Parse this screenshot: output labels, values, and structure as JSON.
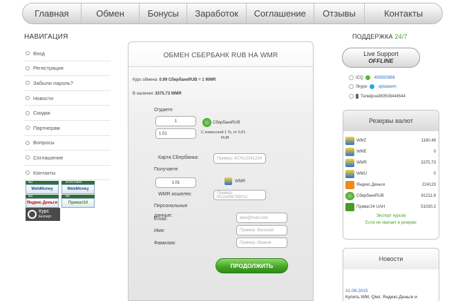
{
  "topnav": [
    "Главная",
    "Обмен",
    "Бонусы",
    "Заработок",
    "Соглашение",
    "Отзывы",
    "Контакты"
  ],
  "left": {
    "title": "НАВИГАЦИЯ",
    "items": [
      "Вход",
      "Регистрация",
      "Забыли пароль?",
      "Новости",
      "Скидки",
      "Партнерам",
      "Вопросы",
      "Соглашение",
      "Контакты"
    ],
    "badges": {
      "accept1": "мы принимаем",
      "wm1": "WebMoney",
      "attested": "аттестован",
      "wm2": "WebMoney",
      "accept2": "мы принимаем",
      "yd": "Яндекс.Деньги",
      "accept3": "мы принимаем",
      "p24": "Приват24",
      "kurs1": "Курс",
      "kurs2": "Експерт"
    }
  },
  "panel": {
    "title": "ОБМЕН СБЕРБАНК RUB НА WMR",
    "rate_label": "Курс обмена:",
    "rate_value": "0.99 СбербанкRUB = 1 WMR",
    "avail_label": "В наличии:",
    "avail_value": "3375.73 WMR",
    "give_label": "Отдаете",
    "give_qty": "1",
    "give_amount": "1.01",
    "give_currency": "СбербанкRUB",
    "commission": "С комиссией 1 %, от 0,01",
    "commission_unit": "RUB",
    "card_label": "Карта СБербанка:",
    "card_placeholder": "Пример: 427612341234",
    "get_label": "Получаете",
    "get_amount": "1.01",
    "get_currency": "WMR",
    "wallet_label": "WMR кошелек:",
    "wallet_placeholder": "Пример: R123456789012",
    "personal_label": "Персональные",
    "personal_label2": "данные:",
    "email_label": "Email:",
    "email_placeholder": "alex@mail.com",
    "name_label": "Имя:",
    "name_placeholder": "Пример: Василий",
    "surname_label": "Фамилия:",
    "surname_placeholder": "Пример: Иванов",
    "submit": "ПРОДОЛЖИТЬ"
  },
  "support": {
    "title": "ПОДДЕРЖКА",
    "title_accent": "24/7",
    "live_line1": "Live Support",
    "live_line2": "OFFLINE",
    "icq_label": "ICQ",
    "icq_value": "406550898",
    "skype_label": "Skype",
    "skype_value": "optatawm",
    "phone_label": "Телефон380508444544"
  },
  "reserves": {
    "title": "Резервы валют",
    "rows": [
      {
        "name": "WMZ",
        "amount": "1180.48"
      },
      {
        "name": "WME",
        "amount": "0"
      },
      {
        "name": "WMR",
        "amount": "3375.73"
      },
      {
        "name": "WMU",
        "amount": "0"
      },
      {
        "name": "Яндекс.Деньги",
        "amount": "224123"
      },
      {
        "name": "СбербанкRUB",
        "amount": "81211.8"
      },
      {
        "name": "Приват24 UAH",
        "amount": "51030.2"
      }
    ],
    "export_link": "Экспорт курсов",
    "notenough_link": "Если не хватает в резерве"
  },
  "news": {
    "title": "Новости",
    "date": "31.08.2015",
    "text": "Купить WM, Qiwi, Яндекс.Деньги и"
  },
  "colors": {
    "accent_green": "#44a21f",
    "link_blue": "#2e6fc1"
  }
}
